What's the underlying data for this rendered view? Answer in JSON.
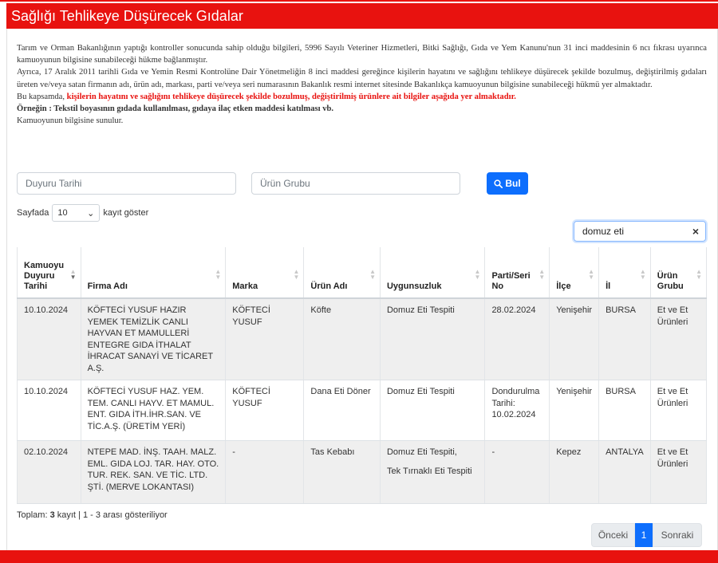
{
  "header": {
    "title": "Sağlığı Tehlikeye Düşürecek Gıdalar"
  },
  "intro": {
    "p1": "Tarım ve Orman Bakanlığının yaptığı kontroller sonucunda sahip olduğu bilgileri, 5996 Sayılı Veteriner Hizmetleri, Bitki Sağlığı, Gıda ve Yem Kanunu'nun 31 inci maddesinin 6 ncı fıkrası uyarınca kamuoyunun bilgisine sunabileceği hükme bağlanmıştır.",
    "p2": "Ayrıca, 17 Aralık 2011 tarihli Gıda ve Yemin Resmi Kontrolüne Dair Yönetmeliğin 8 inci maddesi gereğince kişilerin hayatını ve sağlığını tehlikeye düşürecek şekilde bozulmuş, değiştirilmiş gıdaları üreten ve/veya satan firmanın adı, ürün adı, markası, parti ve/veya seri numarasının Bakanlık resmi internet sitesinde Bakanlıkça kamuoyunun bilgisine sunabileceği hükmü yer almaktadır.",
    "p3_prefix": "Bu kapsamda, ",
    "p3_red": "kişilerin hayatını ve sağlığını tehlikeye düşürecek şekilde bozulmuş, değiştirilmiş ürünlere ait bilgiler aşağıda yer almaktadır.",
    "p4": "Örneğin : Tekstil boyasının gıdada kullanılması, gıdaya ilaç etken maddesi katılması vb.",
    "p5": "Kamuoyunun bilgisine sunulur."
  },
  "filters": {
    "date_placeholder": "Duyuru Tarihi",
    "group_placeholder": "Ürün Grubu",
    "search_button": "Bul"
  },
  "length": {
    "prefix": "Sayfada",
    "value": "10",
    "suffix": "kayıt göster"
  },
  "search": {
    "value": "domuz eti",
    "clear": "×"
  },
  "table": {
    "headers": [
      "Kamuoyu Duyuru Tarihi",
      "Firma Adı",
      "Marka",
      "Ürün Adı",
      "Uygunsuzluk",
      "Parti/Seri No",
      "İlçe",
      "İl",
      "Ürün Grubu"
    ],
    "rows": [
      [
        "10.10.2024",
        "KÖFTECİ YUSUF HAZIR YEMEK TEMİZLİK CANLI HAYVAN ET MAMULLERİ ENTEGRE GIDA İTHALAT İHRACAT SANAYİ VE TİCARET A.Ş.",
        "KÖFTECİ YUSUF",
        "Köfte",
        "Domuz Eti Tespiti",
        "28.02.2024",
        "Yenişehir",
        "BURSA",
        "Et ve Et Ürünleri"
      ],
      [
        "10.10.2024",
        "KÖFTECİ YUSUF HAZ. YEM. TEM. CANLI HAYV. ET MAMUL. ENT. GIDA İTH.İHR.SAN. VE TİC.A.Ş. (ÜRETİM YERİ)",
        "KÖFTECİ YUSUF",
        "Dana Eti Döner",
        "Domuz Eti Tespiti",
        "Dondurulma Tarihi: 10.02.2024",
        "Yenişehir",
        "BURSA",
        "Et ve Et Ürünleri"
      ],
      [
        "02.10.2024",
        "NTEPE MAD. İNŞ. TAAH. MALZ. EML. GIDA LOJ. TAR. HAY. OTO. TUR. REK. SAN. VE TİC. LTD. ŞTİ. (MERVE LOKANTASI)",
        "-",
        "Tas Kebabı",
        "Domuz Eti Tespiti,",
        "-",
        "Kepez",
        "ANTALYA",
        "Et ve Et Ürünleri"
      ]
    ],
    "row3_extra": "Tek Tırnaklı Eti Tespiti"
  },
  "footer": {
    "total_label": "Toplam: ",
    "total_count": "3",
    "total_rest": " kayıt | 1 - 3 arası gösteriliyor"
  },
  "pager": {
    "prev": "Önceki",
    "current": "1",
    "next": "Sonraki"
  },
  "colors": {
    "brand_red": "#e8120f",
    "primary_blue": "#0d6efd"
  }
}
